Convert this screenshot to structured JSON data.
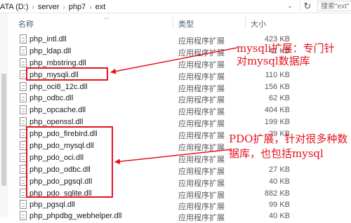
{
  "address": {
    "crumbs": [
      "ATA (D:)",
      "server",
      "php7",
      "ext"
    ],
    "search_placeholder": "搜索\"ext\""
  },
  "columns": {
    "name": "名称",
    "type": "类型",
    "size": "大小"
  },
  "files": [
    {
      "name": "php_intl.dll",
      "type": "应用程序扩展",
      "size": "423 KB"
    },
    {
      "name": "php_ldap.dll",
      "type": "应用程序扩展",
      "size": "41 KB"
    },
    {
      "name": "php_mbstring.dll",
      "type": "应用程序扩展",
      "size": ""
    },
    {
      "name": "php_mysqli.dll",
      "type": "应用程序扩展",
      "size": "110 KB"
    },
    {
      "name": "php_oci8_12c.dll",
      "type": "应用程序扩展",
      "size": "156 KB"
    },
    {
      "name": "php_odbc.dll",
      "type": "应用程序扩展",
      "size": "62 KB"
    },
    {
      "name": "php_opcache.dll",
      "type": "应用程序扩展",
      "size": "404 KB"
    },
    {
      "name": "php_openssl.dll",
      "type": "应用程序扩展",
      "size": "199 KB"
    },
    {
      "name": "php_pdo_firebird.dll",
      "type": "应用程序扩展",
      "size": "29 KB"
    },
    {
      "name": "php_pdo_mysql.dll",
      "type": "应用程序扩展",
      "size": ""
    },
    {
      "name": "php_pdo_oci.dll",
      "type": "应用程序扩展",
      "size": ""
    },
    {
      "name": "php_pdo_odbc.dll",
      "type": "应用程序扩展",
      "size": "27 KB"
    },
    {
      "name": "php_pdo_pgsql.dll",
      "type": "应用程序扩展",
      "size": "40 KB"
    },
    {
      "name": "php_pdo_sqlite.dll",
      "type": "应用程序扩展",
      "size": "882 KB"
    },
    {
      "name": "php_pgsql.dll",
      "type": "应用程序扩展",
      "size": "99 KB"
    },
    {
      "name": "php_phpdbg_webhelper.dll",
      "type": "应用程序扩展",
      "size": "40 KB"
    }
  ],
  "annotations": {
    "mysqli_line1": "mysqli扩展：专门针",
    "mysqli_line2": "对mysql数据库",
    "pdo_line1": "PDO扩展，针对很多种数",
    "pdo_line2": "据库，也包括mysql"
  },
  "colors": {
    "highlight": "#e5121e",
    "header_text": "#4c607a"
  }
}
